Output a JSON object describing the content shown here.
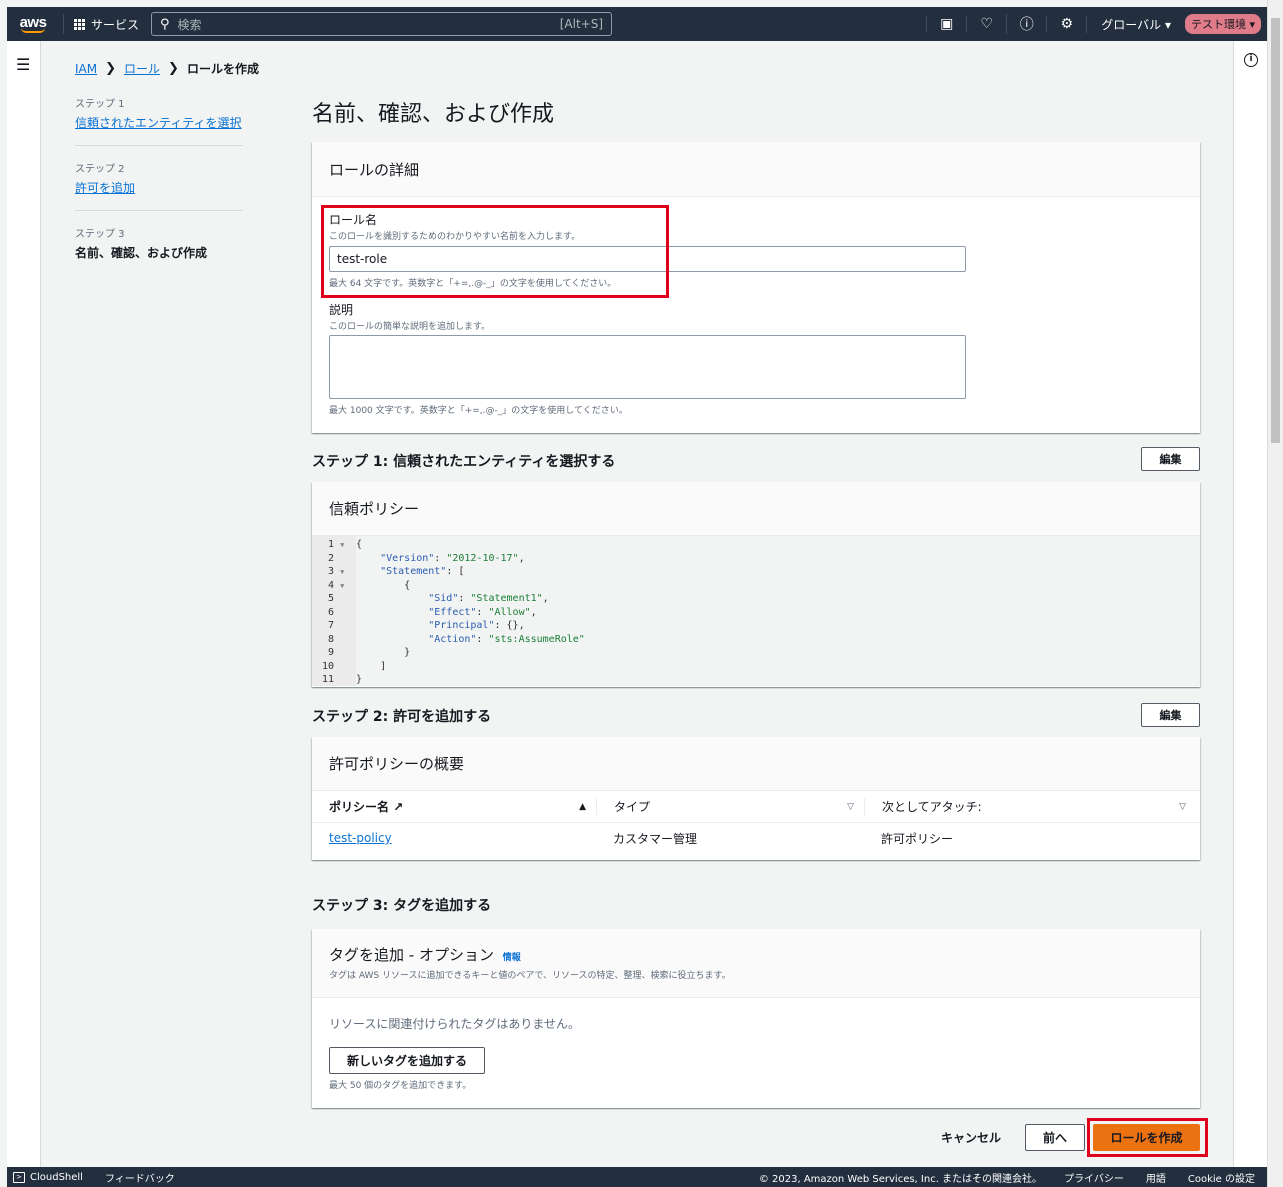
{
  "nav": {
    "logo": "aws",
    "services": "サービス",
    "search_placeholder": "検索",
    "search_shortcut": "[Alt+S]",
    "region": "グローバル ▾",
    "env_badge": "テスト環境 ▾"
  },
  "breadcrumb": {
    "items": [
      "IAM",
      "ロール"
    ],
    "current": "ロールを作成"
  },
  "wizard": {
    "steps": [
      {
        "label": "ステップ 1",
        "title": "信頼されたエンティティを選択"
      },
      {
        "label": "ステップ 2",
        "title": "許可を追加"
      },
      {
        "label": "ステップ 3",
        "title": "名前、確認、および作成"
      }
    ]
  },
  "page_title": "名前、確認、および作成",
  "details": {
    "header": "ロールの詳細",
    "role_name_label": "ロール名",
    "role_name_desc": "このロールを識別するためのわかりやすい名前を入力します。",
    "role_name_value": "test-role",
    "role_name_constraint": "最大 64 文字です。英数字と「+=,.@-_」の文字を使用してください。",
    "description_label": "説明",
    "description_desc": "このロールの簡単な説明を追加します。",
    "description_value": "",
    "description_constraint": "最大 1000 文字です。英数字と「+=,.@-_」の文字を使用してください。"
  },
  "step1": {
    "heading": "ステップ 1: 信頼されたエンティティを選択する",
    "edit": "編集",
    "panel_header": "信頼ポリシー",
    "line_numbers": [
      "1",
      "2",
      "3",
      "4",
      "5",
      "6",
      "7",
      "8",
      "9",
      "10",
      "11"
    ]
  },
  "step2": {
    "heading": "ステップ 2: 許可を追加する",
    "edit": "編集",
    "panel_header": "許可ポリシーの概要",
    "columns": [
      "ポリシー名",
      "タイプ",
      "次としてアタッチ:"
    ],
    "rows": [
      {
        "name": "test-policy",
        "type": "カスタマー管理",
        "attached_as": "許可ポリシー"
      }
    ]
  },
  "step3": {
    "heading": "ステップ 3: タグを追加する",
    "panel_header": "タグを追加 - オプション",
    "info": "情報",
    "panel_desc": "タグは AWS リソースに追加できるキーと値のペアで、リソースの特定、整理、検索に役立ちます。",
    "empty": "リソースに関連付けられたタグはありません。",
    "add_tag": "新しいタグを追加する",
    "limit": "最大 50 個のタグを追加できます。"
  },
  "actions": {
    "cancel": "キャンセル",
    "previous": "前へ",
    "create": "ロールを作成"
  },
  "footer": {
    "cloudshell": "CloudShell",
    "feedback": "フィードバック",
    "copyright": "© 2023, Amazon Web Services, Inc. またはその関連会社。",
    "privacy": "プライバシー",
    "terms": "用語",
    "cookie": "Cookie の設定"
  },
  "colors": {
    "nav_bg": "#232f3e",
    "primary": "#ec7211",
    "link": "#0972d3",
    "highlight": "#e0001b"
  }
}
